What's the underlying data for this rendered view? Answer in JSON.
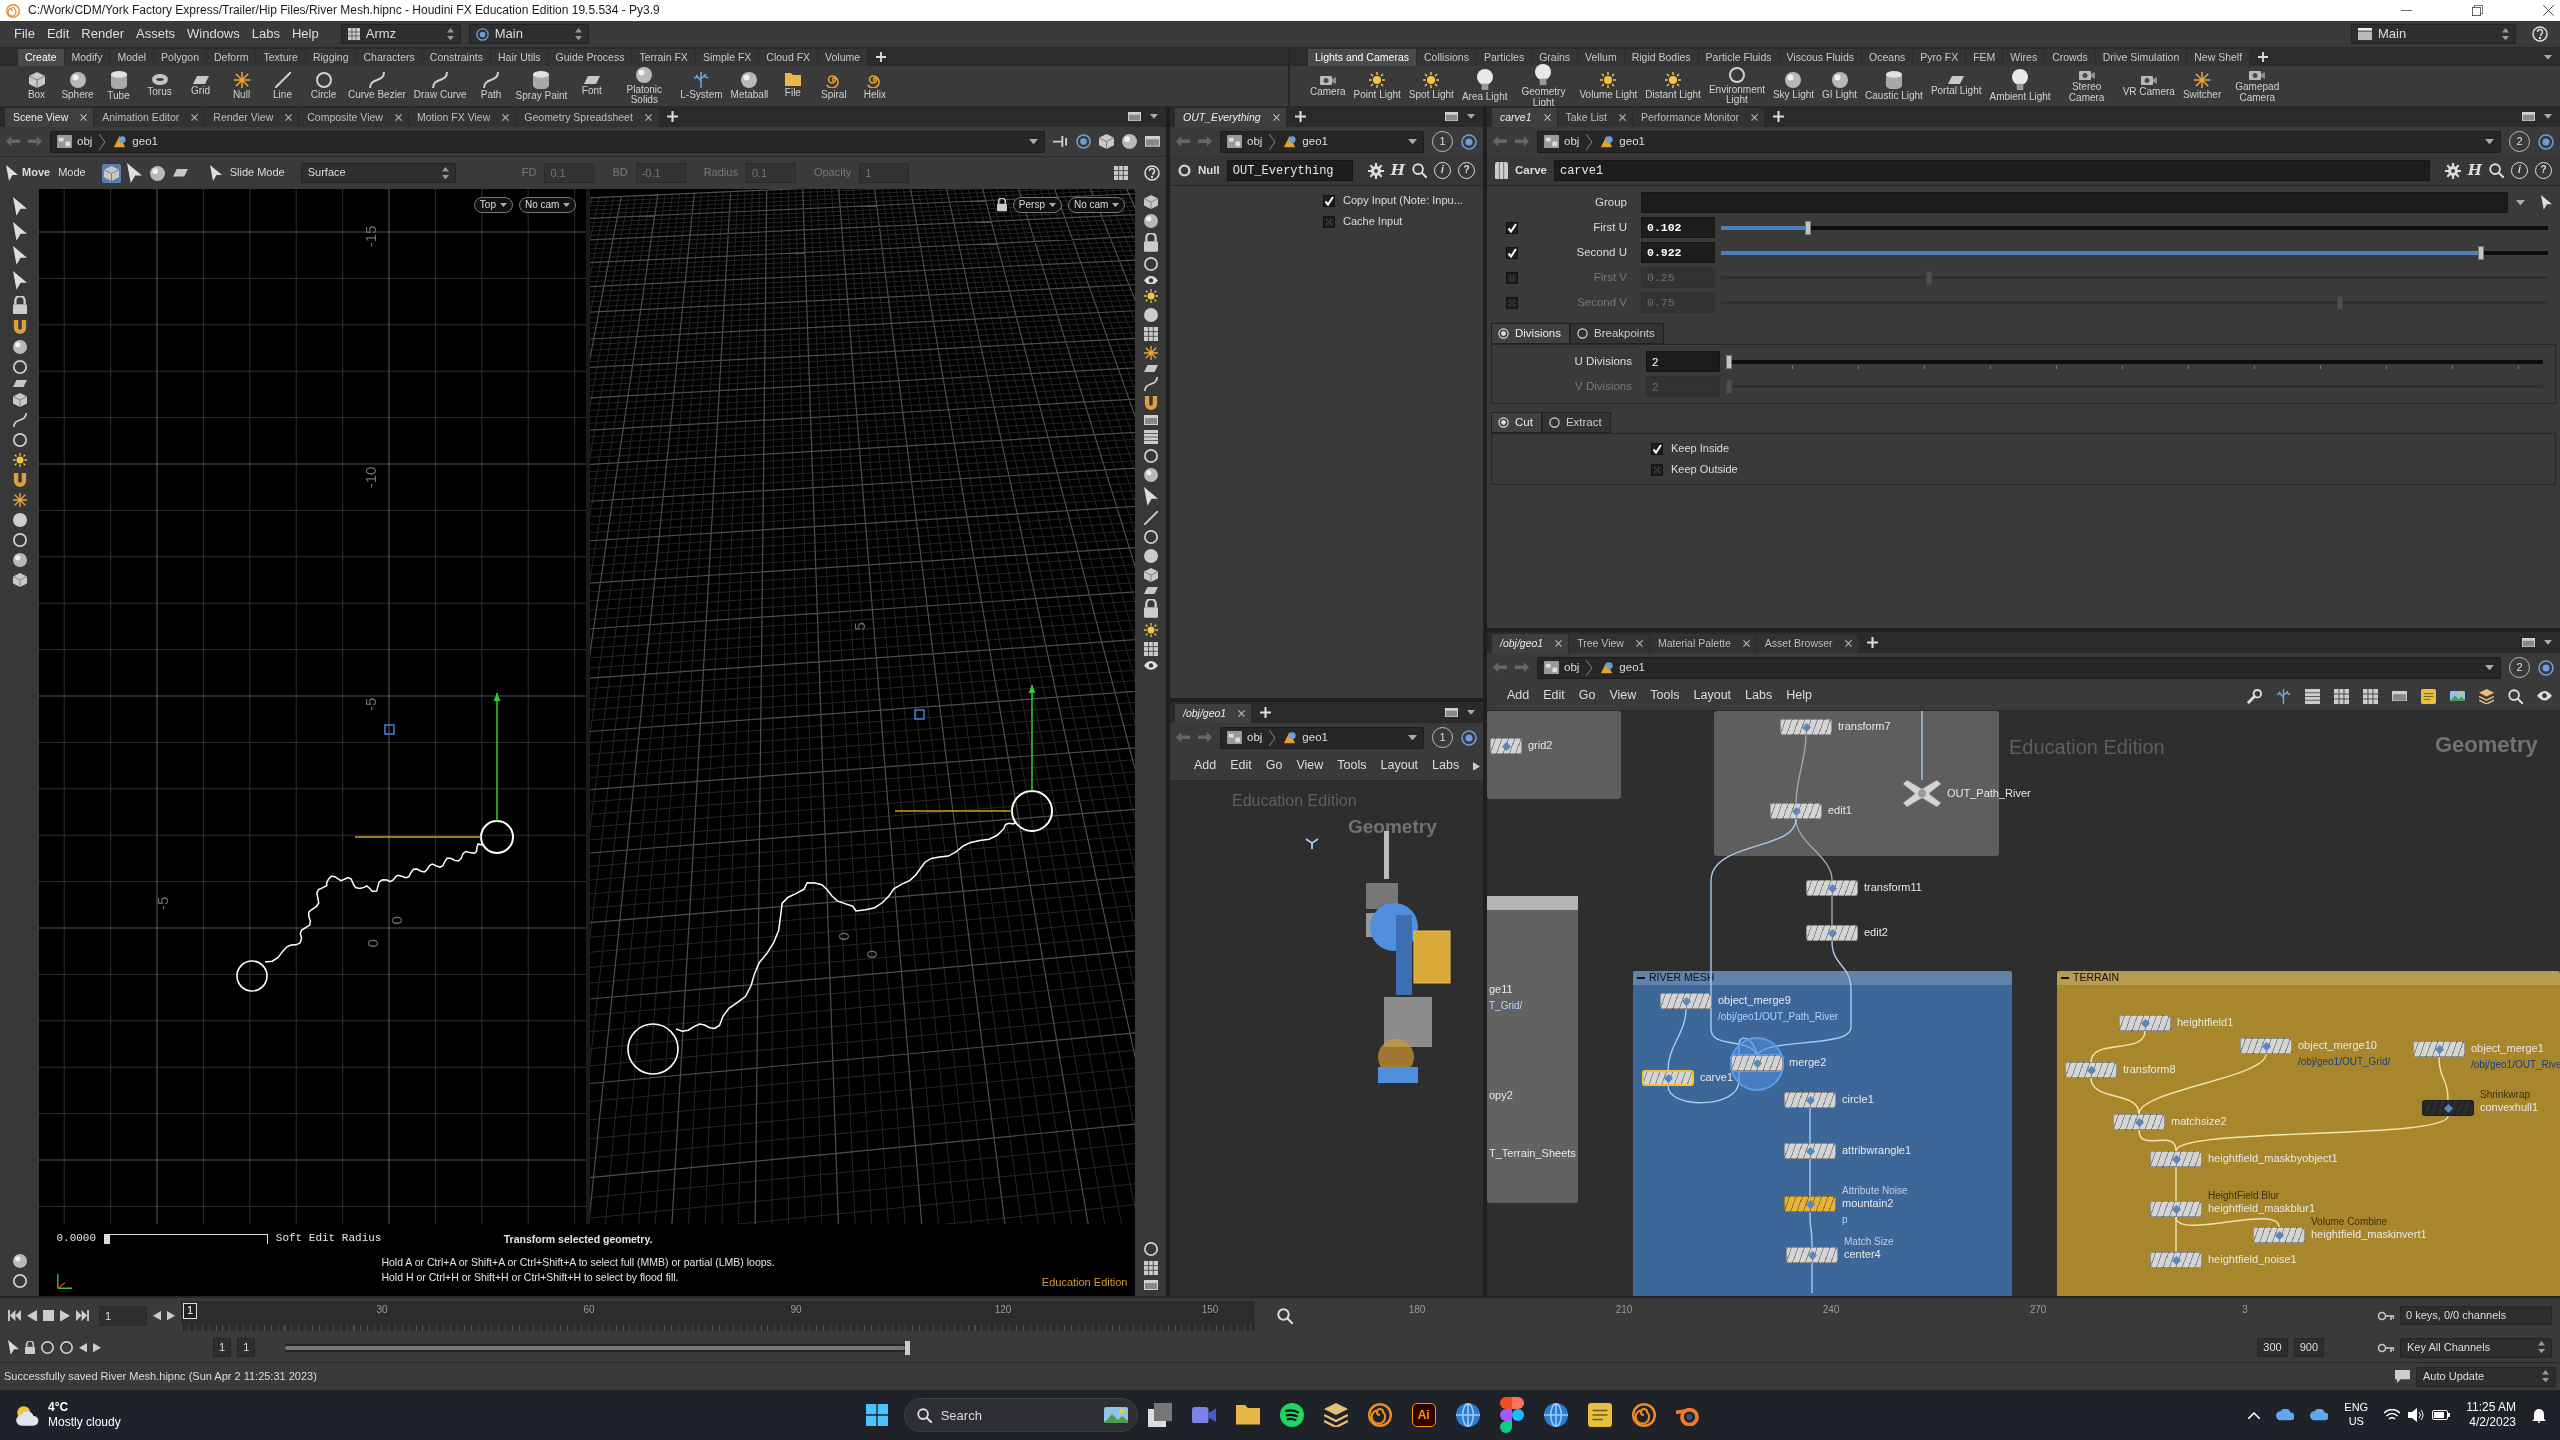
{
  "window": {
    "title": "C:/Work/CDM/York Factory Express/Trailer/Hip Files/River Mesh.hipnc - Houdini FX Education Edition 19.5.534 - Py3.9"
  },
  "menu_bar": {
    "items": [
      "File",
      "Edit",
      "Render",
      "Assets",
      "Windows",
      "Labs",
      "Help"
    ],
    "desktop": "Armz",
    "network_context": "Main",
    "right_desktop": "Main"
  },
  "shelves": [
    {
      "tabs": [
        {
          "label": "Create",
          "selected": true
        },
        {
          "label": "Modify",
          "selected": false
        },
        {
          "label": "Model",
          "selected": false
        },
        {
          "label": "Polygon",
          "selected": false
        },
        {
          "label": "Deform",
          "selected": false
        },
        {
          "label": "Texture",
          "selected": false
        },
        {
          "label": "Rigging",
          "selected": false
        },
        {
          "label": "Characters",
          "selected": false
        },
        {
          "label": "Constraints",
          "selected": false
        },
        {
          "label": "Hair Utils",
          "selected": false
        },
        {
          "label": "Guide Process",
          "selected": false
        },
        {
          "label": "Terrain FX",
          "selected": false
        },
        {
          "label": "Simple FX",
          "selected": false
        },
        {
          "label": "Cloud FX",
          "selected": false
        },
        {
          "label": "Volume",
          "selected": false
        }
      ],
      "tools": [
        "Box",
        "Sphere",
        "Tube",
        "Torus",
        "Grid",
        "Null",
        "Line",
        "Circle",
        "Curve Bezier",
        "Draw Curve",
        "Path",
        "Spray Paint",
        "Font",
        "Platonic Solids",
        "L-System",
        "Metaball",
        "File",
        "Spiral",
        "Helix"
      ]
    },
    {
      "tabs": [
        {
          "label": "Lights and Cameras",
          "selected": true
        },
        {
          "label": "Collisions",
          "selected": false
        },
        {
          "label": "Particles",
          "selected": false
        },
        {
          "label": "Grains",
          "selected": false
        },
        {
          "label": "Vellum",
          "selected": false
        },
        {
          "label": "Rigid Bodies",
          "selected": false
        },
        {
          "label": "Particle Fluids",
          "selected": false
        },
        {
          "label": "Viscous Fluids",
          "selected": false
        },
        {
          "label": "Oceans",
          "selected": false
        },
        {
          "label": "Pyro FX",
          "selected": false
        },
        {
          "label": "FEM",
          "selected": false
        },
        {
          "label": "Wires",
          "selected": false
        },
        {
          "label": "Crowds",
          "selected": false
        },
        {
          "label": "Drive Simulation",
          "selected": false
        },
        {
          "label": "New Shelf",
          "selected": false
        }
      ],
      "tools": [
        "Camera",
        "Point Light",
        "Spot Light",
        "Area Light",
        "Geometry Light",
        "Volume Light",
        "Distant Light",
        "Environment Light",
        "Sky Light",
        "GI Light",
        "Caustic Light",
        "Portal Light",
        "Ambient Light",
        "Stereo Camera",
        "VR Camera",
        "Switcher",
        "Gamepad Camera"
      ]
    }
  ],
  "scene_view": {
    "tabs": [
      {
        "label": "Scene View",
        "selected": true
      },
      {
        "label": "Animation Editor",
        "selected": false
      },
      {
        "label": "Render View",
        "selected": false
      },
      {
        "label": "Composite View",
        "selected": false
      },
      {
        "label": "Motion FX View",
        "selected": false
      },
      {
        "label": "Geometry Spreadsheet",
        "selected": false
      }
    ],
    "path": [
      "obj",
      "geo1"
    ],
    "toolbar": {
      "tool": "Move",
      "mode": "Mode",
      "select_buttons": [
        {
          "selected": true
        },
        {
          "selected": false
        },
        {
          "selected": false
        },
        {
          "selected": false
        }
      ],
      "slide_label": "Slide Mode",
      "surface": "Surface",
      "fields": [
        {
          "label": "FD",
          "value": "0.1",
          "disabled": true
        },
        {
          "label": "BD",
          "value": "-0.1",
          "disabled": true
        },
        {
          "label": "Radius",
          "value": "0.1",
          "disabled": true
        },
        {
          "label": "Opacity",
          "value": "1",
          "disabled": true
        }
      ]
    },
    "views": [
      {
        "projection": "Top",
        "camera": "No cam",
        "grid_labels": [
          "-15",
          "-10",
          "-5",
          "0",
          "0",
          "-5"
        ]
      },
      {
        "projection": "Persp",
        "camera": "No cam",
        "grid_labels": [
          "5",
          "0",
          "0"
        ]
      }
    ],
    "soft_edit": {
      "value": "0.0000",
      "level": 0,
      "label": "Soft Edit Radius"
    },
    "help": {
      "title": "Transform selected geometry.",
      "lines": [
        "Hold A or Ctrl+A or Shift+A or Ctrl+Shift+A to select full (MMB) or partial (LMB) loops.",
        "Hold H or Ctrl+H or Shift+H or Ctrl+Shift+H to select by flood fill."
      ]
    },
    "edition": "Education Edition"
  },
  "null_params": {
    "tabs": [
      {
        "label": "OUT_Everything",
        "selected": true
      }
    ],
    "path": [
      "obj",
      "geo1"
    ],
    "pane_number": "1",
    "header": {
      "node_type": "Null",
      "node_name": "OUT_Everything",
      "glyphs": [
        "H",
        "i",
        "?"
      ]
    },
    "toggles": [
      {
        "label": "Copy Input (Note: Inpu...",
        "checked": true
      },
      {
        "label": "Cache Input",
        "checked": false
      }
    ]
  },
  "mini_network": {
    "tabs": [
      {
        "label": "/obj/geo1",
        "selected": true
      }
    ],
    "path": [
      "obj",
      "geo1"
    ],
    "pane_number": "1",
    "menu": [
      "Add",
      "Edit",
      "Go",
      "View",
      "Tools",
      "Layout",
      "Labs"
    ],
    "edition": "Education Edition",
    "context": "Geometry"
  },
  "parameters": {
    "tabs": [
      {
        "label": "carve1",
        "selected": true
      },
      {
        "label": "Take List",
        "selected": false
      },
      {
        "label": "Performance Monitor",
        "selected": false
      }
    ],
    "path": [
      "obj",
      "geo1"
    ],
    "pane_number": "2",
    "header": {
      "node_type": "Carve",
      "node_name": "carve1",
      "glyphs": [
        "H",
        "i",
        "?"
      ]
    },
    "group": {
      "label": "Group"
    },
    "sliders": [
      {
        "label": "First U",
        "value": "0.102",
        "level": 0.102,
        "checked": true,
        "disabled": false
      },
      {
        "label": "Second U",
        "value": "0.922",
        "level": 0.922,
        "checked": true,
        "disabled": false
      },
      {
        "label": "First V",
        "value": "0.25",
        "level": 0.25,
        "checked": false,
        "disabled": true
      },
      {
        "label": "Second V",
        "value": "0.75",
        "level": 0.75,
        "checked": false,
        "disabled": true
      }
    ],
    "division_tabs": [
      {
        "label": "Divisions",
        "selected": true
      },
      {
        "label": "Breakpoints",
        "selected": false
      }
    ],
    "divisions": [
      {
        "label": "U Divisions",
        "value": "2",
        "level": 0,
        "disabled": false
      },
      {
        "label": "V Divisions",
        "value": "2",
        "level": 0,
        "disabled": true
      }
    ],
    "cut_tabs": [
      {
        "label": "Cut",
        "selected": true
      },
      {
        "label": "Extract",
        "selected": false
      }
    ],
    "keep": [
      {
        "label": "Keep Inside",
        "checked": true
      },
      {
        "label": "Keep Outside",
        "checked": false
      }
    ]
  },
  "network": {
    "tabs": [
      {
        "label": "/obj/geo1",
        "selected": true
      },
      {
        "label": "Tree View",
        "selected": false
      },
      {
        "label": "Material Palette",
        "selected": false
      },
      {
        "label": "Asset Browser",
        "selected": false
      }
    ],
    "path": [
      "obj",
      "geo1"
    ],
    "pane_number": "2",
    "menu": [
      "Add",
      "Edit",
      "Go",
      "View",
      "Tools",
      "Layout",
      "Labs",
      "Help"
    ],
    "edition": "Education Edition",
    "context": "Geometry",
    "boxes": [
      {
        "color": "#5e5e5e"
      },
      {
        "color": "#5e5e5e"
      },
      {
        "color": "#626262"
      },
      {
        "title": "RIVER MESH",
        "color": "#3e6799"
      },
      {
        "title": "TERRAIN",
        "color": "#a8872c"
      }
    ],
    "offscreen_labels": [
      {
        "name": "ge11",
        "path": "T_Grid/"
      },
      {
        "name": "opy2"
      },
      {
        "name": "T_Terrain_Sheets"
      }
    ],
    "nodes": [
      {
        "name": "grid2",
        "kind": "node",
        "color": "#d4d4d4",
        "selected": false,
        "display": false
      },
      {
        "name": "transform7",
        "kind": "node",
        "color": "#d4d4d4",
        "selected": false,
        "display": false
      },
      {
        "name": "edit1",
        "kind": "node",
        "color": "#d4d4d4",
        "selected": false,
        "display": false
      },
      {
        "name": "OUT_Path_River",
        "kind": "null",
        "color": "#d4d4d4",
        "selected": false,
        "display": false
      },
      {
        "name": "transform11",
        "kind": "node",
        "color": "#d4d4d4",
        "selected": false,
        "display": false
      },
      {
        "name": "edit2",
        "kind": "node",
        "color": "#d4d4d4",
        "selected": false,
        "display": false
      },
      {
        "name": "object_merge9",
        "kind": "node",
        "color": "#d4d4d4",
        "selected": false,
        "display": false,
        "path": "/obj/geo1/OUT_Path_River"
      },
      {
        "name": "carve1",
        "kind": "node",
        "color": "#d4d4d4",
        "selected": true,
        "display": false
      },
      {
        "name": "merge2",
        "kind": "node",
        "color": "#d4d4d4",
        "selected": false,
        "display": true
      },
      {
        "name": "circle1",
        "kind": "node",
        "color": "#d4d4d4",
        "selected": false,
        "display": false
      },
      {
        "name": "attribwrangle1",
        "kind": "node",
        "color": "#d4d4d4",
        "selected": false,
        "display": false
      },
      {
        "name": "mountain2",
        "kind": "node",
        "color": "#e6b33a",
        "selected": false,
        "display": false,
        "comment": "Attribute Noise",
        "path": "p"
      },
      {
        "name": "center4",
        "kind": "node",
        "color": "#d4d4d4",
        "selected": false,
        "display": false,
        "comment": "Match Size"
      },
      {
        "name": "heightfield1",
        "kind": "node",
        "color": "#d4d4d4",
        "selected": false,
        "display": false
      },
      {
        "name": "transform8",
        "kind": "node",
        "color": "#d4d4d4",
        "selected": false,
        "display": false
      },
      {
        "name": "object_merge10",
        "kind": "node",
        "color": "#d4d4d4",
        "selected": false,
        "display": false,
        "path": "/obj/geo1/OUT_Grid/"
      },
      {
        "name": "object_merge1",
        "kind": "node",
        "color": "#d4d4d4",
        "selected": false,
        "display": false,
        "path": "/obj/geo1/OUT_Rive"
      },
      {
        "name": "matchsize2",
        "kind": "node",
        "color": "#d4d4d4",
        "selected": false,
        "display": false
      },
      {
        "name": "convexhull1",
        "kind": "node",
        "color": "#2c2c2c",
        "selected": false,
        "display": false,
        "comment": "Shrinkwrap"
      },
      {
        "name": "heightfield_maskbyobject1",
        "kind": "node",
        "color": "#d4d4d4",
        "selected": false,
        "display": false
      },
      {
        "name": "heightfield_maskblur1",
        "kind": "node",
        "color": "#d4d4d4",
        "selected": false,
        "display": false,
        "comment": "HeightField Blur"
      },
      {
        "name": "heightfield_maskinvert1",
        "kind": "node",
        "color": "#d4d4d4",
        "selected": false,
        "display": false,
        "comment": "Volume Combine"
      },
      {
        "name": "heightfield_noise1",
        "kind": "node",
        "color": "#d4d4d4",
        "selected": false,
        "display": false
      }
    ]
  },
  "timeline": {
    "frame": "1",
    "marker": "1",
    "ticks": [
      "30",
      "60",
      "90",
      "120",
      "150",
      "180",
      "210",
      "240",
      "270",
      "3"
    ],
    "keys": "0 keys, 0/0 channels"
  },
  "range_bar": {
    "start_fields": [
      "1",
      "1"
    ],
    "level": 1,
    "end_fields": [
      "300",
      "900"
    ],
    "key_mode": "Key All Channels"
  },
  "status_bar": {
    "message": "Successfully saved River Mesh.hipnc (Sun Apr 2 11:25:31 2023)",
    "update_mode": "Auto Update"
  },
  "taskbar": {
    "weather": {
      "temperature": "4°C",
      "condition": "Mostly cloudy"
    },
    "search": {
      "placeholder": "Search"
    },
    "apps": [
      {
        "kind": "stack"
      },
      {
        "kind": "video"
      },
      {
        "kind": "folder"
      },
      {
        "kind": "music"
      },
      {
        "kind": "layers"
      },
      {
        "kind": "swirl"
      },
      {
        "kind": "text",
        "label": "Ai"
      },
      {
        "kind": "globe"
      },
      {
        "kind": "shapes"
      },
      {
        "kind": "globe"
      },
      {
        "kind": "note"
      },
      {
        "kind": "swirl"
      },
      {
        "kind": "bring"
      }
    ],
    "language": "ENG",
    "region": "US",
    "time": "11:25 AM",
    "date": "4/2/2023"
  }
}
